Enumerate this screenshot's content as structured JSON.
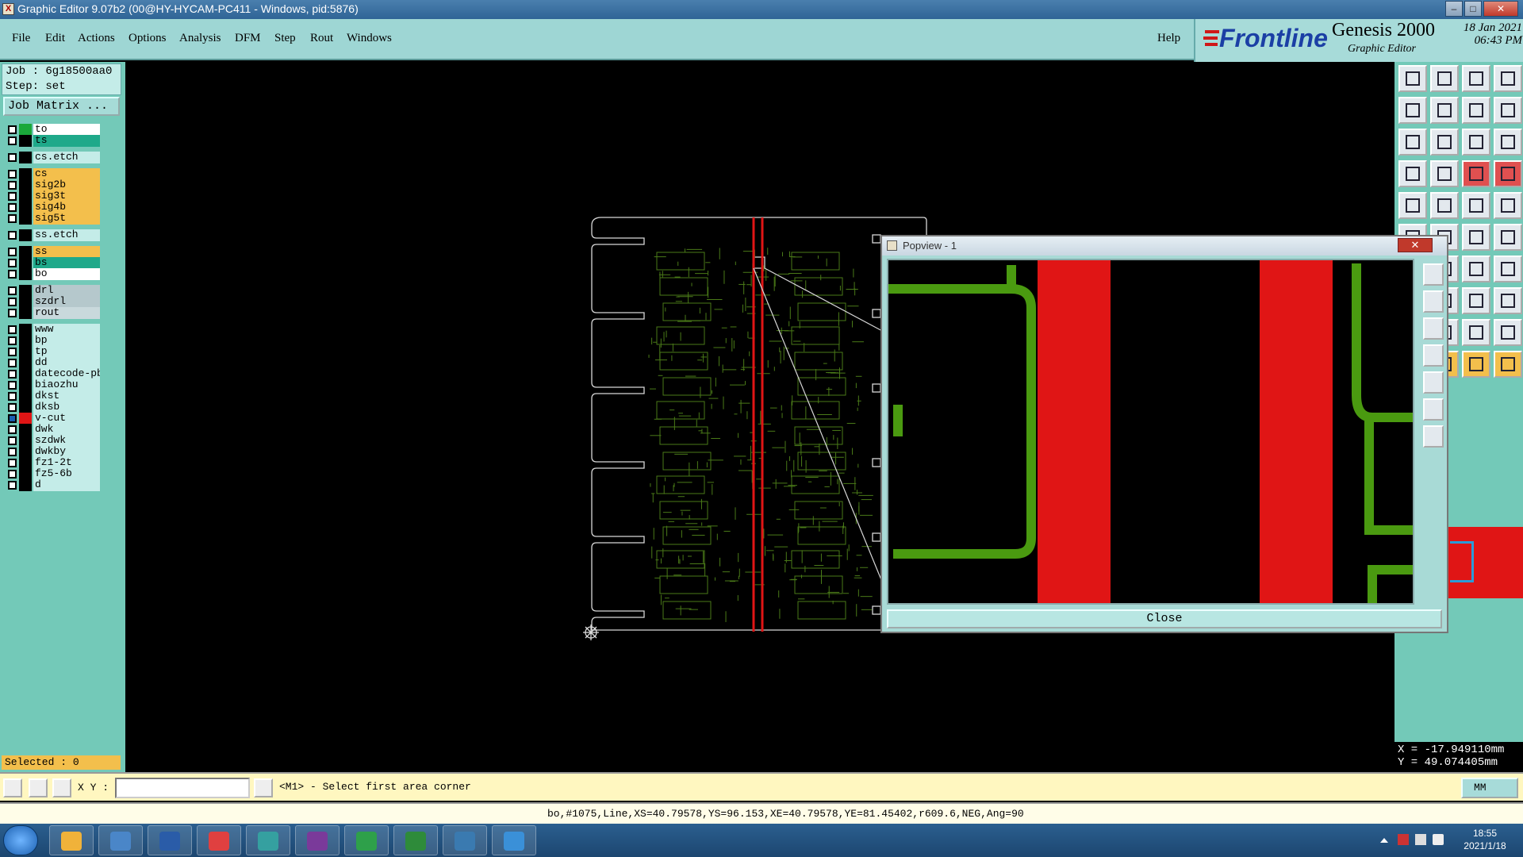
{
  "window": {
    "title": "Graphic Editor 9.07b2 (00@HY-HYCAM-PC411 - Windows, pid:5876)",
    "controls": [
      "–",
      "□",
      "✕"
    ]
  },
  "menu": {
    "items": [
      "File",
      "Edit",
      "Actions",
      "Options",
      "Analysis",
      "DFM",
      "Step",
      "Rout",
      "Windows"
    ],
    "help": "Help"
  },
  "logo": {
    "brand": "Frontline",
    "product": "Genesis 2000",
    "subtitle": "Graphic Editor",
    "date": "18 Jan 2021",
    "time": "06:43 PM"
  },
  "job": {
    "job_label": "Job  :  6g18500aa0",
    "step_label": "Step:  set",
    "matrix_button": "Job Matrix ..."
  },
  "layers": [
    {
      "name": "to",
      "color": "#ffffff",
      "swatch": "#1aa83a"
    },
    {
      "name": "ts",
      "color": "#1fa98a",
      "swatch": "#000000"
    },
    {
      "name": "cs.etch",
      "color": "#c4ece8",
      "swatch": "#000000"
    },
    {
      "name": "cs",
      "color": "#f3bf4c",
      "swatch": "#000000"
    },
    {
      "name": "sig2b",
      "color": "#f3bf4c",
      "swatch": "#000000"
    },
    {
      "name": "sig3t",
      "color": "#f3bf4c",
      "swatch": "#000000"
    },
    {
      "name": "sig4b",
      "color": "#f3bf4c",
      "swatch": "#000000"
    },
    {
      "name": "sig5t",
      "color": "#f3bf4c",
      "swatch": "#000000"
    },
    {
      "name": "ss.etch",
      "color": "#c4ece8",
      "swatch": "#000000"
    },
    {
      "name": "ss",
      "color": "#f3bf4c",
      "swatch": "#000000"
    },
    {
      "name": "bs",
      "color": "#1fa98a",
      "swatch": "#000000"
    },
    {
      "name": "bo",
      "color": "#ffffff",
      "swatch": "#000000"
    },
    {
      "name": "drl",
      "color": "#b5c8cc",
      "swatch": "#000000"
    },
    {
      "name": "szdrl",
      "color": "#b5c8cc",
      "swatch": "#000000"
    },
    {
      "name": "rout",
      "color": "#c9d9dc",
      "swatch": "#000000"
    },
    {
      "name": "www",
      "color": "#c4ece8",
      "swatch": "#000000"
    },
    {
      "name": "bp",
      "color": "#c4ece8",
      "swatch": "#000000"
    },
    {
      "name": "tp",
      "color": "#c4ece8",
      "swatch": "#000000"
    },
    {
      "name": "dd",
      "color": "#c4ece8",
      "swatch": "#000000"
    },
    {
      "name": "datecode-pbe",
      "color": "#c4ece8",
      "swatch": "#000000"
    },
    {
      "name": "biaozhu",
      "color": "#c4ece8",
      "swatch": "#000000"
    },
    {
      "name": "dkst",
      "color": "#c4ece8",
      "swatch": "#000000"
    },
    {
      "name": "dksb",
      "color": "#c4ece8",
      "swatch": "#000000"
    },
    {
      "name": "v-cut",
      "color": "#c4ece8",
      "swatch": "#e01515"
    },
    {
      "name": "dwk",
      "color": "#c4ece8",
      "swatch": "#000000"
    },
    {
      "name": "szdwk",
      "color": "#c4ece8",
      "swatch": "#000000"
    },
    {
      "name": "dwkby",
      "color": "#c4ece8",
      "swatch": "#000000"
    },
    {
      "name": "fz1-2t",
      "color": "#c4ece8",
      "swatch": "#000000"
    },
    {
      "name": "fz5-6b",
      "color": "#c4ece8",
      "swatch": "#000000"
    },
    {
      "name": "d",
      "color": "#c4ece8",
      "swatch": "#000000"
    }
  ],
  "selected": "Selected : 0",
  "popview": {
    "title": "Popview - 1",
    "close_x": "✕",
    "close_button": "Close"
  },
  "coords": {
    "x": "X  =  -17.949110mm",
    "y": "Y  =  49.074405mm"
  },
  "command": {
    "xy_label": "X Y :",
    "xy_value": "",
    "prompt": "<M1> - Select first area corner",
    "units": "MM"
  },
  "status": {
    "text": "bo,#1075,Line,XS=40.79578,YS=96.153,XE=40.79578,YE=81.45402,r609.6,NEG,Ang=90"
  },
  "taskbar": {
    "time": "18:55",
    "date": "2021/1/18",
    "apps": [
      "shell-icon",
      "notepad-icon",
      "save-icon",
      "g-icon",
      "eye-icon",
      "x-icon",
      "p-icon",
      "excel-icon",
      "eye2-icon",
      "bird-icon"
    ]
  },
  "colors": {
    "panel": "#73c9b8",
    "menubar": "#9ed6d4",
    "vcut": "#e01515",
    "trace": "#4a8a14"
  }
}
